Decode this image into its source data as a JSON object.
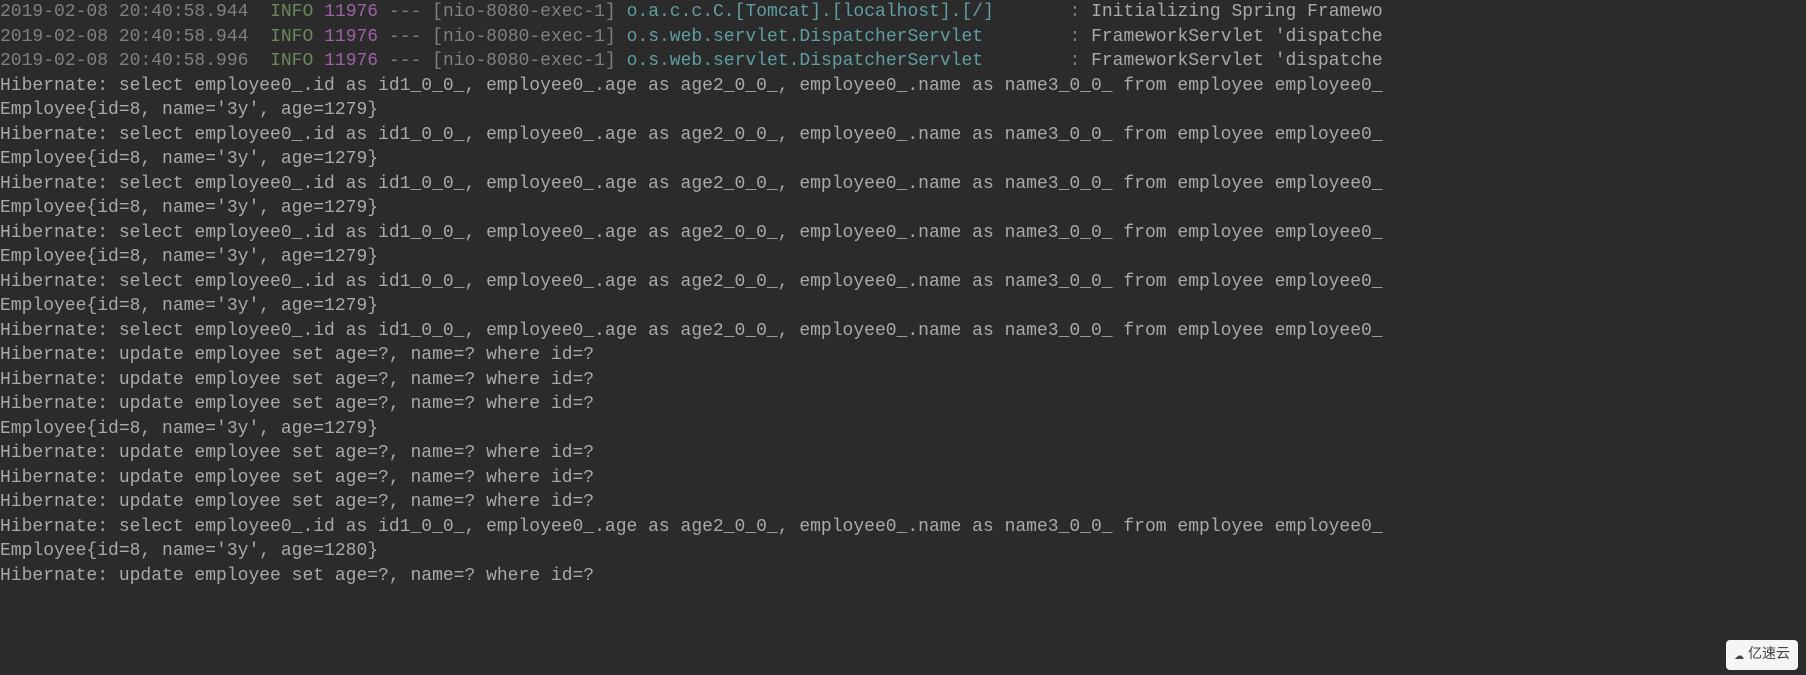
{
  "spring_lines": [
    {
      "timestamp": "2019-02-08 20:40:58.944",
      "level": "INFO",
      "pid": "11976",
      "sep": "---",
      "thread": "[nio-8080-exec-1]",
      "logger": "o.a.c.c.C.[Tomcat].[localhost].[/]      ",
      "message": "Initializing Spring Framewo"
    },
    {
      "timestamp": "2019-02-08 20:40:58.944",
      "level": "INFO",
      "pid": "11976",
      "sep": "---",
      "thread": "[nio-8080-exec-1]",
      "logger": "o.s.web.servlet.DispatcherServlet       ",
      "message": "FrameworkServlet 'dispatche"
    },
    {
      "timestamp": "2019-02-08 20:40:58.996",
      "level": "INFO",
      "pid": "11976",
      "sep": "---",
      "thread": "[nio-8080-exec-1]",
      "logger": "o.s.web.servlet.DispatcherServlet       ",
      "message": "FrameworkServlet 'dispatche"
    }
  ],
  "plain_lines": [
    "Hibernate: select employee0_.id as id1_0_0_, employee0_.age as age2_0_0_, employee0_.name as name3_0_0_ from employee employee0_",
    "Employee{id=8, name='3y', age=1279}",
    "Hibernate: select employee0_.id as id1_0_0_, employee0_.age as age2_0_0_, employee0_.name as name3_0_0_ from employee employee0_",
    "Employee{id=8, name='3y', age=1279}",
    "Hibernate: select employee0_.id as id1_0_0_, employee0_.age as age2_0_0_, employee0_.name as name3_0_0_ from employee employee0_",
    "Employee{id=8, name='3y', age=1279}",
    "Hibernate: select employee0_.id as id1_0_0_, employee0_.age as age2_0_0_, employee0_.name as name3_0_0_ from employee employee0_",
    "Employee{id=8, name='3y', age=1279}",
    "Hibernate: select employee0_.id as id1_0_0_, employee0_.age as age2_0_0_, employee0_.name as name3_0_0_ from employee employee0_",
    "Employee{id=8, name='3y', age=1279}",
    "Hibernate: select employee0_.id as id1_0_0_, employee0_.age as age2_0_0_, employee0_.name as name3_0_0_ from employee employee0_",
    "Hibernate: update employee set age=?, name=? where id=?",
    "Hibernate: update employee set age=?, name=? where id=?",
    "Hibernate: update employee set age=?, name=? where id=?",
    "Employee{id=8, name='3y', age=1279}",
    "Hibernate: update employee set age=?, name=? where id=?",
    "Hibernate: update employee set age=?, name=? where id=?",
    "Hibernate: update employee set age=?, name=? where id=?",
    "Hibernate: select employee0_.id as id1_0_0_, employee0_.age as age2_0_0_, employee0_.name as name3_0_0_ from employee employee0_",
    "Employee{id=8, name='3y', age=1280}",
    "Hibernate: update employee set age=?, name=? where id=?"
  ],
  "watermark": "亿速云"
}
